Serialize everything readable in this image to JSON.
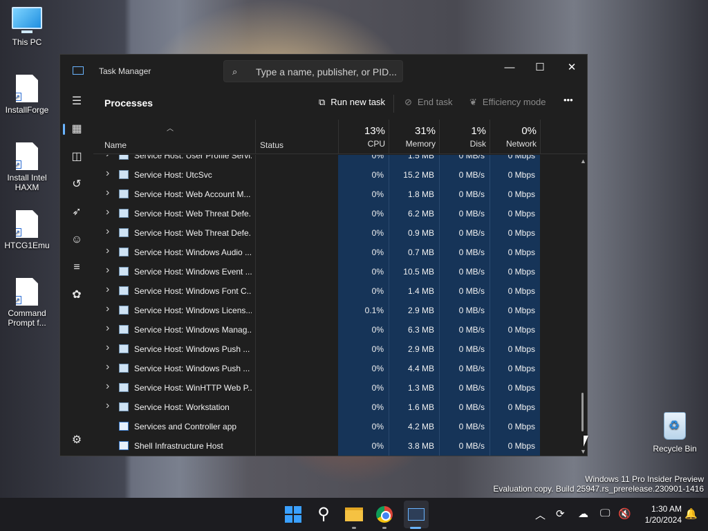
{
  "desktop": {
    "icons": [
      {
        "label": "This PC",
        "glyph": "computer-icon"
      },
      {
        "label": "InstallForge",
        "glyph": "shortcut-file-icon"
      },
      {
        "label": "Install Intel HAXM",
        "glyph": "shortcut-file-icon"
      },
      {
        "label": "HTCG1Emu",
        "glyph": "shortcut-file-icon"
      },
      {
        "label": "Command Prompt f...",
        "glyph": "shortcut-file-icon"
      }
    ],
    "recycle_bin": "Recycle Bin",
    "watermark": {
      "line1": "Windows 11 Pro Insider Preview",
      "line2": "Evaluation copy. Build 25947.rs_prerelease.230901-1416"
    }
  },
  "window": {
    "title": "Task Manager",
    "search_placeholder": "Type a name, publisher, or PID...",
    "controls": {
      "minimize": "—",
      "maximize": "☐",
      "close": "✕"
    }
  },
  "sidebar": {
    "items": [
      {
        "icon": "hamburger-menu-icon",
        "glyph": "☰"
      },
      {
        "icon": "processes-icon",
        "glyph": "▦",
        "active": true
      },
      {
        "icon": "performance-icon",
        "glyph": "◫"
      },
      {
        "icon": "app-history-icon",
        "glyph": "↺"
      },
      {
        "icon": "startup-apps-icon",
        "glyph": "➶"
      },
      {
        "icon": "users-icon",
        "glyph": "☺"
      },
      {
        "icon": "details-icon",
        "glyph": "≡"
      },
      {
        "icon": "services-icon",
        "glyph": "✿"
      },
      {
        "icon": "settings-icon",
        "glyph": "⚙"
      }
    ]
  },
  "toolbar": {
    "page_title": "Processes",
    "run_new_task": "Run new task",
    "end_task": "End task",
    "efficiency_mode": "Efficiency mode",
    "more": "•••"
  },
  "columns": {
    "name": "Name",
    "status": "Status",
    "cpu": {
      "pct": "13%",
      "label": "CPU"
    },
    "memory": {
      "pct": "31%",
      "label": "Memory"
    },
    "disk": {
      "pct": "1%",
      "label": "Disk"
    },
    "network": {
      "pct": "0%",
      "label": "Network"
    }
  },
  "processes": [
    {
      "name": "Service Host: User Profile Servi...",
      "cpu": "0%",
      "memory": "1.5 MB",
      "disk": "0 MB/s",
      "network": "0 Mbps",
      "expandable": true
    },
    {
      "name": "Service Host: UtcSvc",
      "cpu": "0%",
      "memory": "15.2 MB",
      "disk": "0 MB/s",
      "network": "0 Mbps",
      "expandable": true
    },
    {
      "name": "Service Host: Web Account M...",
      "cpu": "0%",
      "memory": "1.8 MB",
      "disk": "0 MB/s",
      "network": "0 Mbps",
      "expandable": true
    },
    {
      "name": "Service Host: Web Threat Defe...",
      "cpu": "0%",
      "memory": "6.2 MB",
      "disk": "0 MB/s",
      "network": "0 Mbps",
      "expandable": true
    },
    {
      "name": "Service Host: Web Threat Defe...",
      "cpu": "0%",
      "memory": "0.9 MB",
      "disk": "0 MB/s",
      "network": "0 Mbps",
      "expandable": true
    },
    {
      "name": "Service Host: Windows Audio ...",
      "cpu": "0%",
      "memory": "0.7 MB",
      "disk": "0 MB/s",
      "network": "0 Mbps",
      "expandable": true
    },
    {
      "name": "Service Host: Windows Event ...",
      "cpu": "0%",
      "memory": "10.5 MB",
      "disk": "0 MB/s",
      "network": "0 Mbps",
      "expandable": true
    },
    {
      "name": "Service Host: Windows Font C...",
      "cpu": "0%",
      "memory": "1.4 MB",
      "disk": "0 MB/s",
      "network": "0 Mbps",
      "expandable": true
    },
    {
      "name": "Service Host: Windows Licens...",
      "cpu": "0.1%",
      "memory": "2.9 MB",
      "disk": "0 MB/s",
      "network": "0 Mbps",
      "expandable": true
    },
    {
      "name": "Service Host: Windows Manag...",
      "cpu": "0%",
      "memory": "6.3 MB",
      "disk": "0 MB/s",
      "network": "0 Mbps",
      "expandable": true
    },
    {
      "name": "Service Host: Windows Push ...",
      "cpu": "0%",
      "memory": "2.9 MB",
      "disk": "0 MB/s",
      "network": "0 Mbps",
      "expandable": true
    },
    {
      "name": "Service Host: Windows Push ...",
      "cpu": "0%",
      "memory": "4.4 MB",
      "disk": "0 MB/s",
      "network": "0 Mbps",
      "expandable": true
    },
    {
      "name": "Service Host: WinHTTP Web P...",
      "cpu": "0%",
      "memory": "1.3 MB",
      "disk": "0 MB/s",
      "network": "0 Mbps",
      "expandable": true
    },
    {
      "name": "Service Host: Workstation",
      "cpu": "0%",
      "memory": "1.6 MB",
      "disk": "0 MB/s",
      "network": "0 Mbps",
      "expandable": true
    },
    {
      "name": "Services and Controller app",
      "cpu": "0%",
      "memory": "4.2 MB",
      "disk": "0 MB/s",
      "network": "0 Mbps",
      "expandable": false
    },
    {
      "name": "Shell Infrastructure Host",
      "cpu": "0%",
      "memory": "3.8 MB",
      "disk": "0 MB/s",
      "network": "0 Mbps",
      "expandable": false
    }
  ],
  "taskbar": {
    "apps": [
      "start-icon",
      "search-icon",
      "file-explorer-icon",
      "chrome-icon",
      "task-manager-icon"
    ],
    "tray": [
      "show-hidden-icons-chevron-icon",
      "sync-icon",
      "onedrive-icon",
      "network-icon",
      "volume-muted-icon"
    ],
    "time": "1:30 AM",
    "date": "1/20/2024",
    "notification": "notification-bell-icon"
  },
  "colors": {
    "accent": "#6ab4ff",
    "metric_highlight": "#163458",
    "window_bg": "#1f1f1f"
  }
}
